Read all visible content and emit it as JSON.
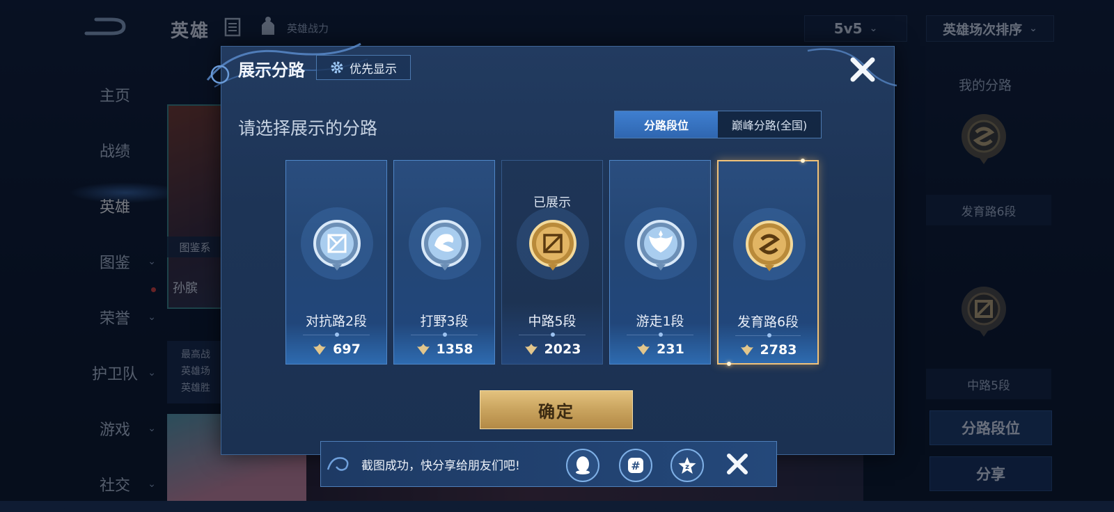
{
  "top_bar": {
    "title": "英雄",
    "power_label": "英雄战力",
    "mode_select": "5v5",
    "sort_select": "英雄场次排序"
  },
  "nav": {
    "items": [
      {
        "label": "主页",
        "active": false,
        "has_chevron": false
      },
      {
        "label": "战绩",
        "active": false,
        "has_chevron": false
      },
      {
        "label": "英雄",
        "active": true,
        "has_chevron": false
      },
      {
        "label": "图鉴",
        "active": false,
        "has_chevron": true
      },
      {
        "label": "荣誉",
        "active": false,
        "has_chevron": true
      },
      {
        "label": "护卫队",
        "active": false,
        "has_chevron": true
      },
      {
        "label": "游戏",
        "active": false,
        "has_chevron": true
      },
      {
        "label": "社交",
        "active": false,
        "has_chevron": true
      }
    ]
  },
  "hero_panel": {
    "tag": "图鉴系",
    "name": "孙膑",
    "stats": [
      "最高战",
      "英雄场",
      "英雄胜"
    ]
  },
  "right_panel": {
    "title": "我的分路",
    "rank_1": "发育路6段",
    "rank_2": "中路5段",
    "lane_rank_button": "分路段位",
    "share_button": "分享"
  },
  "modal": {
    "title": "展示分路",
    "priority_button": "优先显示",
    "subtitle": "请选择展示的分路",
    "tabs": [
      {
        "label": "分路段位",
        "active": true
      },
      {
        "label": "巅峰分路(全国)",
        "active": false
      }
    ],
    "cards": [
      {
        "lane": "对抗路2段",
        "score": "697",
        "shown_label": "",
        "medal": "silver",
        "symbol": "clash"
      },
      {
        "lane": "打野3段",
        "score": "1358",
        "shown_label": "",
        "medal": "silver",
        "symbol": "jungle"
      },
      {
        "lane": "中路5段",
        "score": "2023",
        "shown_label": "已展示",
        "medal": "gold",
        "symbol": "mid"
      },
      {
        "lane": "游走1段",
        "score": "231",
        "shown_label": "",
        "medal": "silver",
        "symbol": "roam"
      },
      {
        "lane": "发育路6段",
        "score": "2783",
        "shown_label": "",
        "medal": "gold",
        "symbol": "farm",
        "selected": true
      }
    ],
    "confirm_button": "确定"
  },
  "toast": {
    "text": "截图成功，快分享给朋友们吧!",
    "share_targets": [
      "qq-icon",
      "moments-icon",
      "qzone-icon"
    ]
  },
  "colors": {
    "accent_blue": "#2f66b0",
    "gold": "#c9a35e",
    "selected_border": "#f0c27a"
  }
}
